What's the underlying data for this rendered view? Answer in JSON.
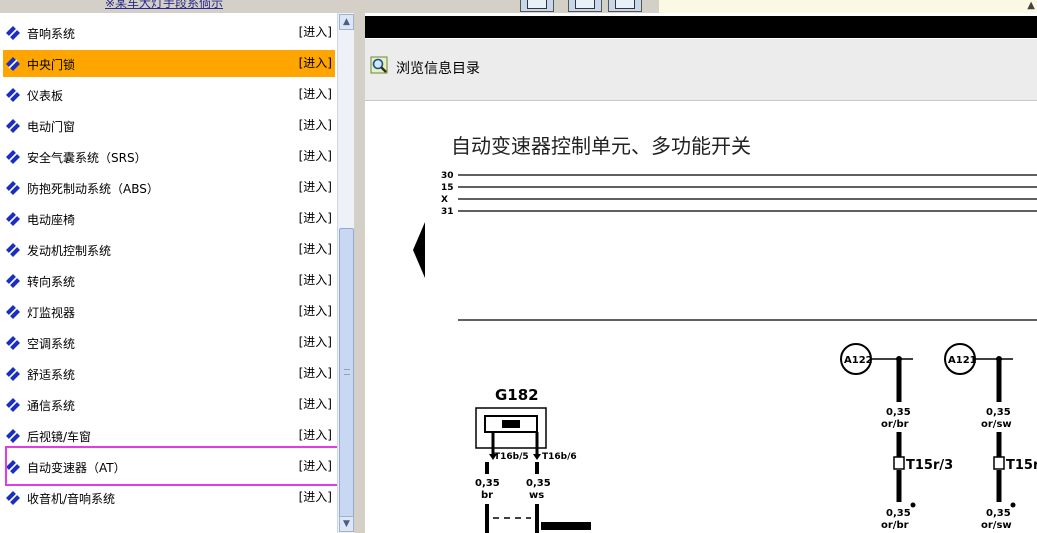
{
  "top": {
    "link_text": "※某车大灯手段系倘示"
  },
  "menu": {
    "enter_label": "[进入]",
    "items": [
      {
        "label": "音响系统",
        "enter": "[进入]"
      },
      {
        "label": "中央门锁",
        "enter": "[进入]"
      },
      {
        "label": "仪表板",
        "enter": "[进入]"
      },
      {
        "label": "电动门窗",
        "enter": "[进入]"
      },
      {
        "label": "安全气囊系统（SRS）",
        "enter": "[进入]"
      },
      {
        "label": "防抱死制动系统（ABS）",
        "enter": "[进入]"
      },
      {
        "label": "电动座椅",
        "enter": "[进入]"
      },
      {
        "label": "发动机控制系统",
        "enter": "[进入]"
      },
      {
        "label": "转向系统",
        "enter": "[进入]"
      },
      {
        "label": "灯监视器",
        "enter": "[进入]"
      },
      {
        "label": "空调系统",
        "enter": "[进入]"
      },
      {
        "label": "舒适系统",
        "enter": "[进入]"
      },
      {
        "label": "通信系统",
        "enter": "[进入]"
      },
      {
        "label": "后视镜/车窗",
        "enter": "[进入]"
      },
      {
        "label": "自动变速器（AT）",
        "enter": "[进入]"
      },
      {
        "label": "收音机/音响系统",
        "enter": "[进入]"
      }
    ],
    "selected_index": 1,
    "highlighted_index": 14
  },
  "colors": {
    "selected_bg": "#ffa500",
    "highlight_border": "#e23ce6",
    "bullet_blue": "#1a2fc0"
  },
  "toolbar": {
    "browse_label": "浏览信息目录",
    "browse_icon": "magnifier-icon"
  },
  "diagram": {
    "title": "自动变速器控制单元、多功能开关",
    "bus_labels": [
      "30",
      "15",
      "X",
      "31"
    ],
    "component": "G182",
    "connectors": [
      "T16b/5",
      "T16b/6"
    ],
    "wire_left": {
      "gauge": "0,35",
      "color": "br"
    },
    "wire_right": {
      "gauge": "0,35",
      "color": "ws"
    },
    "ref_a": "A122",
    "ref_b": "A121",
    "wire_a": {
      "gauge": "0,35",
      "color": "or/br"
    },
    "wire_b": {
      "gauge": "0,35",
      "color": "or/sw"
    },
    "connector_a": "T15r/3",
    "connector_b": "T15r",
    "wire_a2": {
      "gauge": "0,35",
      "color": "or/br"
    },
    "wire_b2": {
      "gauge": "0,35",
      "color": "or/sw"
    }
  }
}
